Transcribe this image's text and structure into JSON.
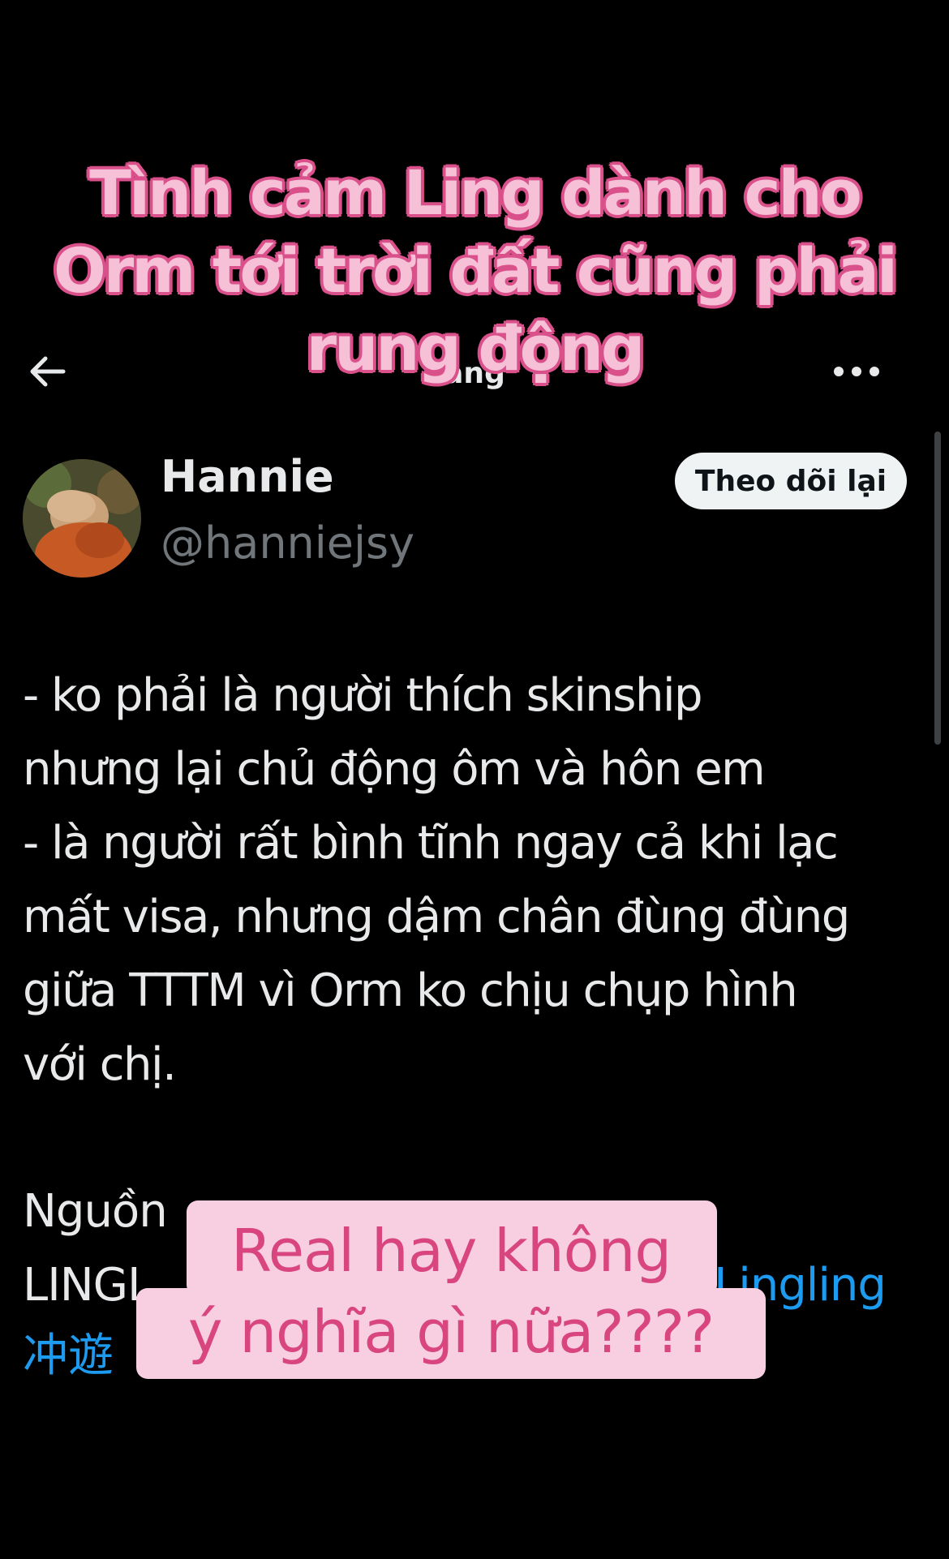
{
  "overlay": {
    "caption": "Tình cảm Ling dành cho\nOrm tới trời đất cũng phải\nrung động",
    "sticker": "Real hay không\ný nghĩa gì nữa????"
  },
  "header": {
    "title": "ăng",
    "back_icon": "arrow-left-icon",
    "more_icon": "ellipsis-horizontal-icon"
  },
  "profile": {
    "display_name": "Hannie",
    "handle": "@hanniejsy",
    "follow_label": "Theo dõi lại"
  },
  "tweet": {
    "body": "- ko phải là người thích skinship\nnhưng lại chủ động ôm và hôn em\n- là người rất bình tĩnh ngay cả khi lạc\nmất visa, nhưng dậm chân đùng đùng\ngiữa TTTM vì Orm ko chịu chụp hình\nvới chị.",
    "source_start": "Nguồn",
    "source_line2_start": "LINGL",
    "source_link_end": "Lingling",
    "source_link_line3": "冲遊"
  },
  "colors": {
    "background": "#000000",
    "text": "#e7e9ea",
    "secondary_text": "#71767b",
    "link": "#1d9bf0",
    "caption_fill": "#f6c0d6",
    "caption_outline": "#d9508a",
    "sticker_bg": "#f7cfe0",
    "sticker_text": "#d9457f"
  }
}
